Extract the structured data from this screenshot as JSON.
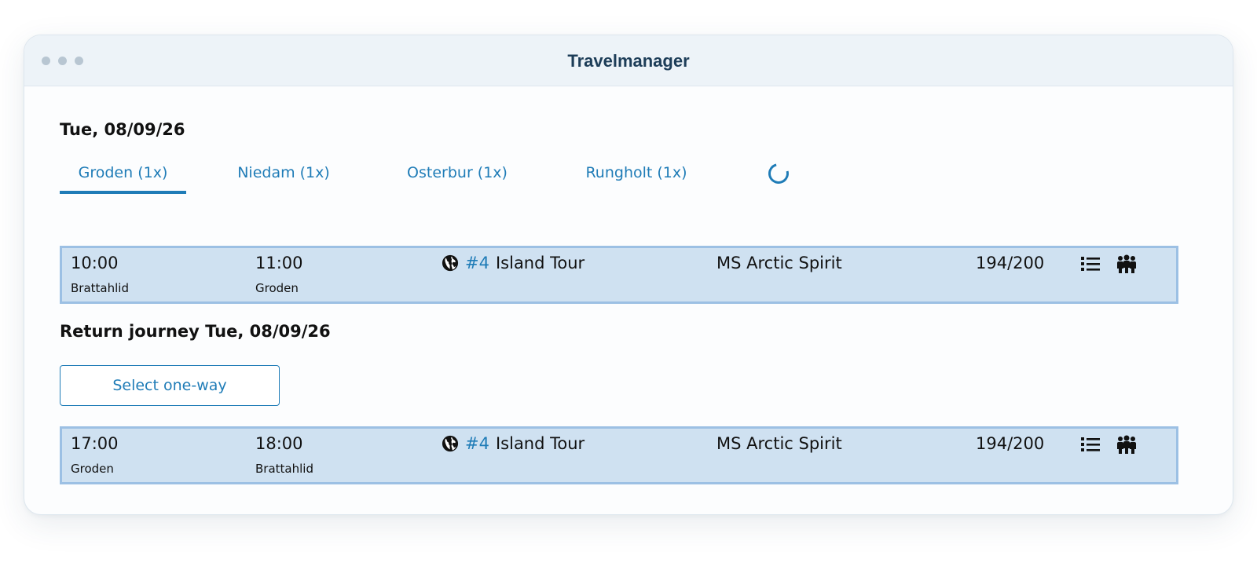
{
  "window": {
    "title": "Travelmanager"
  },
  "outbound": {
    "heading": "Tue, 08/09/26",
    "tabs": [
      {
        "label": "Groden (1x)",
        "active": true
      },
      {
        "label": "Niedam (1x)",
        "active": false
      },
      {
        "label": "Osterbur (1x)",
        "active": false
      },
      {
        "label": "Rungholt (1x)",
        "active": false
      }
    ],
    "trip": {
      "depart_time": "10:00",
      "depart_place": "Brattahlid",
      "arrive_time": "11:00",
      "arrive_place": "Groden",
      "route_number": "#4",
      "route_name": "Island Tour",
      "ship": "MS Arctic Spirit",
      "capacity": "194/200"
    }
  },
  "return": {
    "heading": "Return journey Tue, 08/09/26",
    "select_label": "Select one-way",
    "trip": {
      "depart_time": "17:00",
      "depart_place": "Groden",
      "arrive_time": "18:00",
      "arrive_place": "Brattahlid",
      "route_number": "#4",
      "route_name": "Island Tour",
      "ship": "MS Arctic Spirit",
      "capacity": "194/200"
    }
  },
  "icons": {
    "route": "globe-icon",
    "details": "list-icon",
    "passengers": "people-icon",
    "loading": "spinner-icon"
  },
  "colors": {
    "accent": "#1f7cb7",
    "row_background": "#cfe1f1",
    "row_border": "#9cc0e4",
    "titlebar": "#edf3f8"
  }
}
